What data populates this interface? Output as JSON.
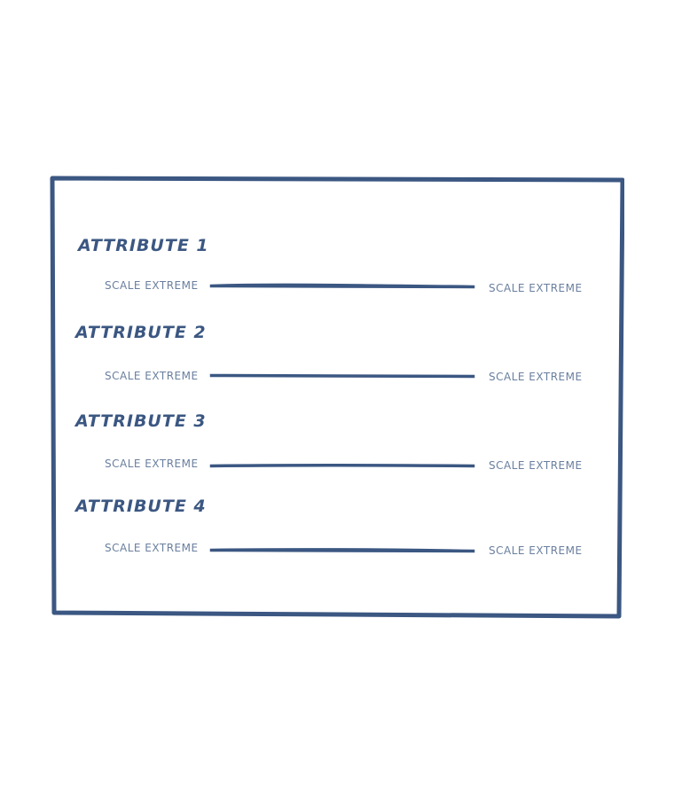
{
  "attributes": [
    {
      "title": "Attribute 1",
      "left_extreme": "Scale Extreme",
      "right_extreme": "Scale Extreme"
    },
    {
      "title": "Attribute 2",
      "left_extreme": "Scale Extreme",
      "right_extreme": "Scale Extreme"
    },
    {
      "title": "Attribute 3",
      "left_extreme": "Scale Extreme",
      "right_extreme": "Scale Extreme"
    },
    {
      "title": "Attribute 4",
      "left_extreme": "Scale Extreme",
      "right_extreme": "Scale Extreme"
    }
  ],
  "colors": {
    "ink": "#3b5782",
    "label": "#6a7f9f",
    "background": "#ffffff"
  }
}
